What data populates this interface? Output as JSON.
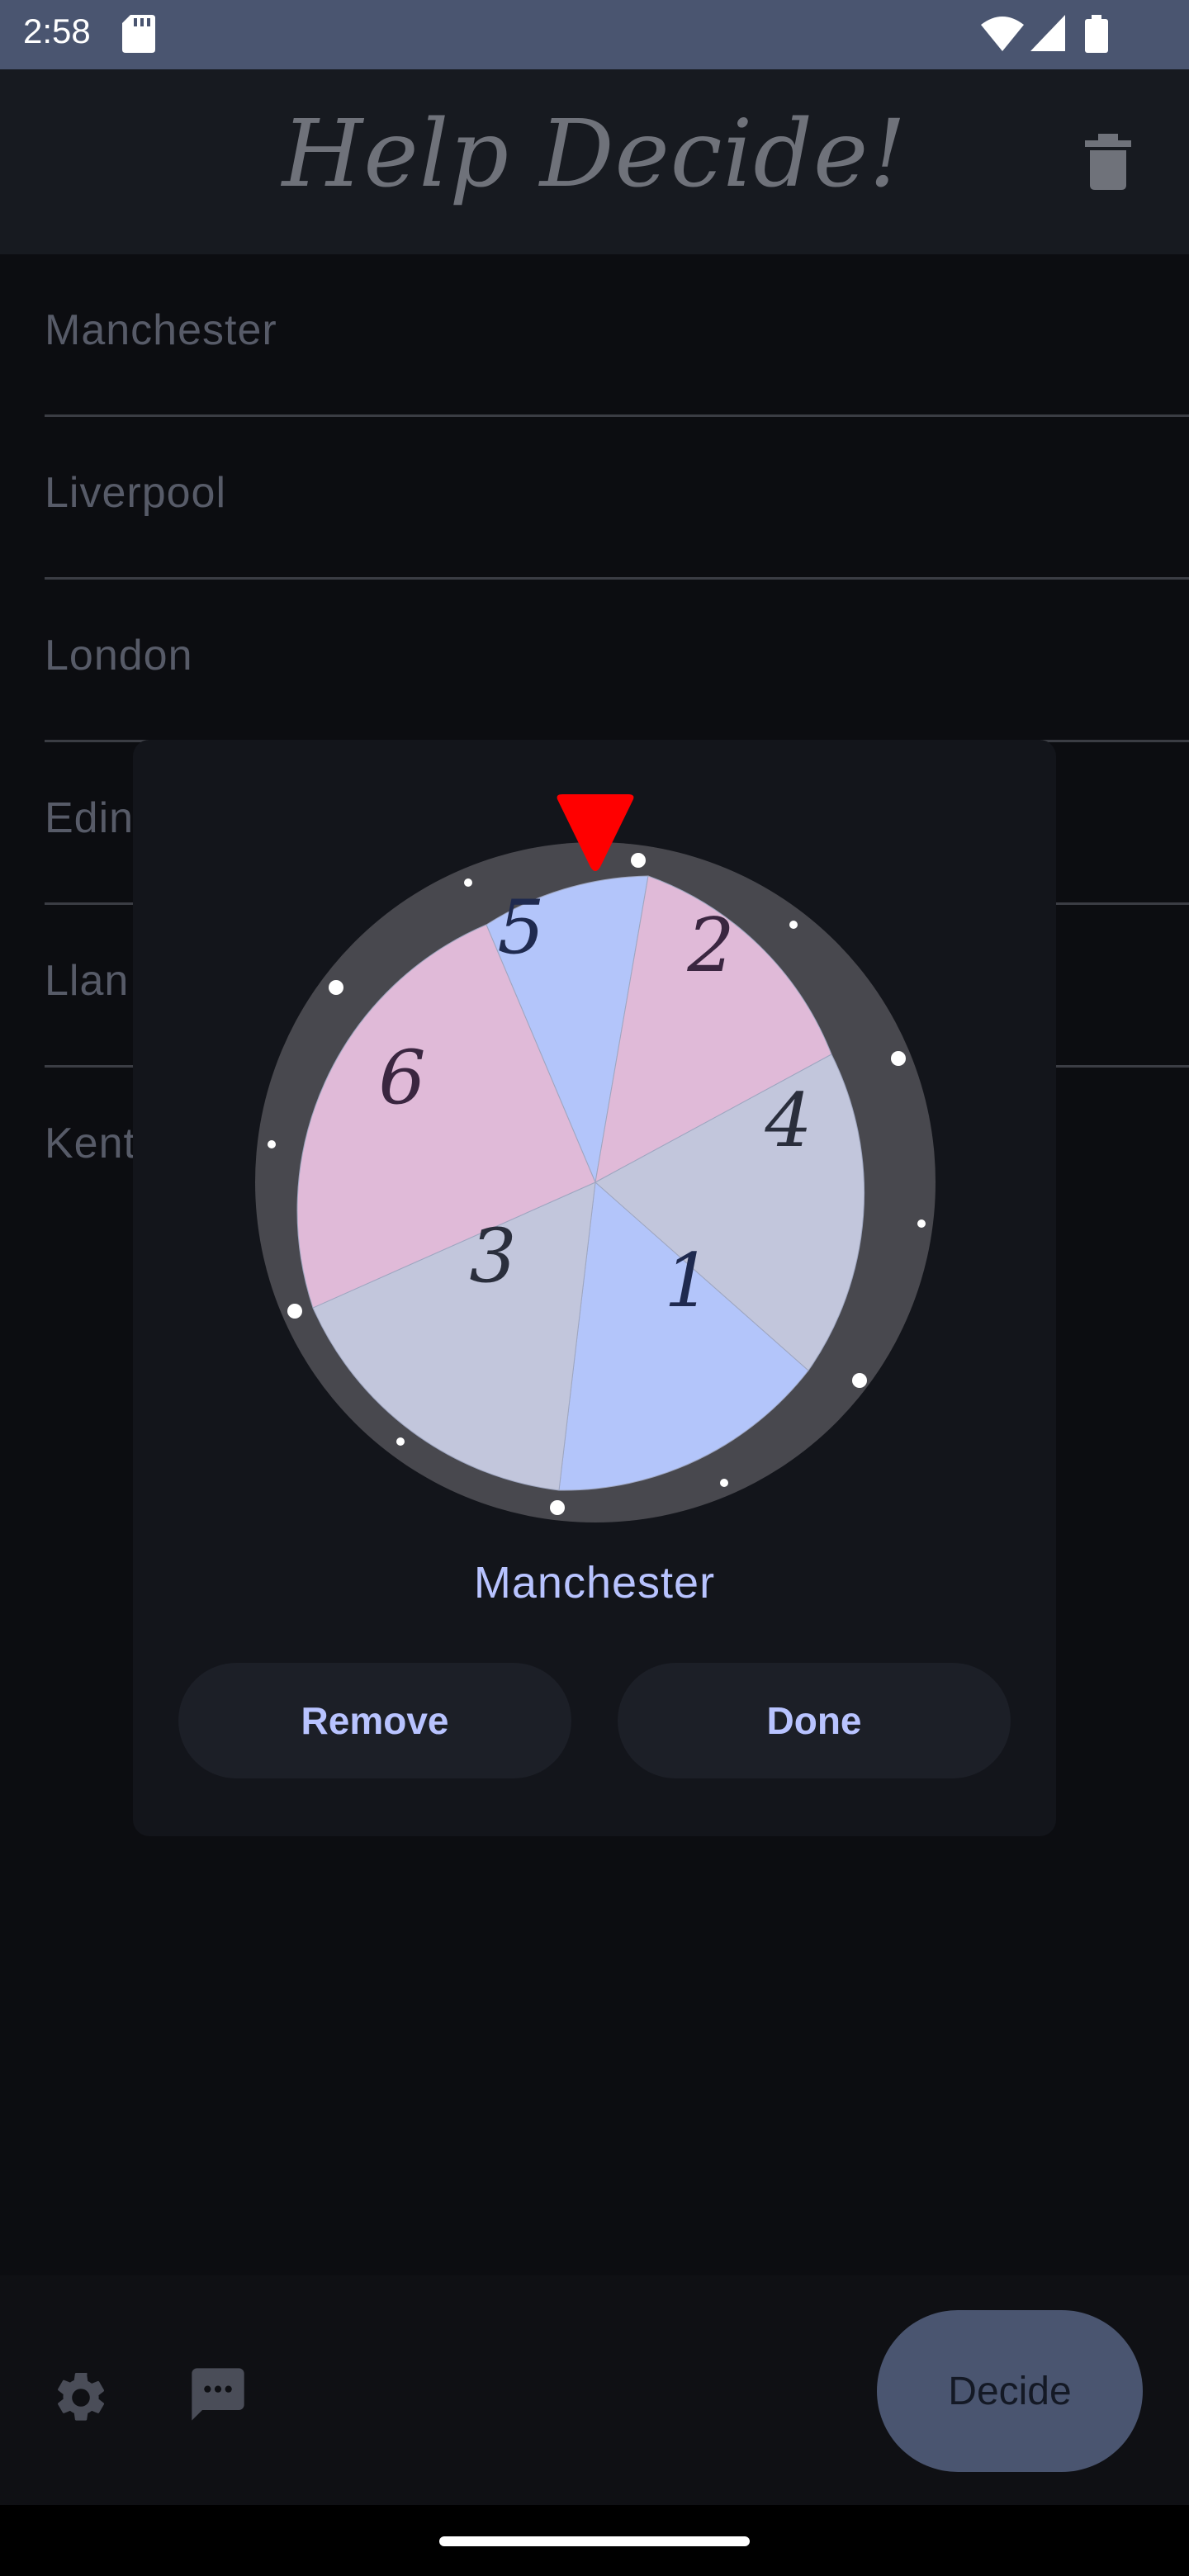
{
  "status_bar": {
    "time": "2:58"
  },
  "app_bar": {
    "title": "Help Decide!"
  },
  "options": [
    "Manchester",
    "Liverpool",
    "London",
    "Edin",
    "Llan",
    "Kent"
  ],
  "dialog": {
    "wheel_labels": [
      "5",
      "2",
      "4",
      "1",
      "3",
      "6"
    ],
    "result": "Manchester",
    "remove_label": "Remove",
    "done_label": "Done"
  },
  "bottom_bar": {
    "decide_label": "Decide"
  },
  "colors": {
    "accent": "#b8c3ff",
    "pointer": "#ff0000",
    "segment_blue": "#b3c5fa",
    "segment_pink": "#e0bad8",
    "segment_grey": "#c2c6dc"
  }
}
